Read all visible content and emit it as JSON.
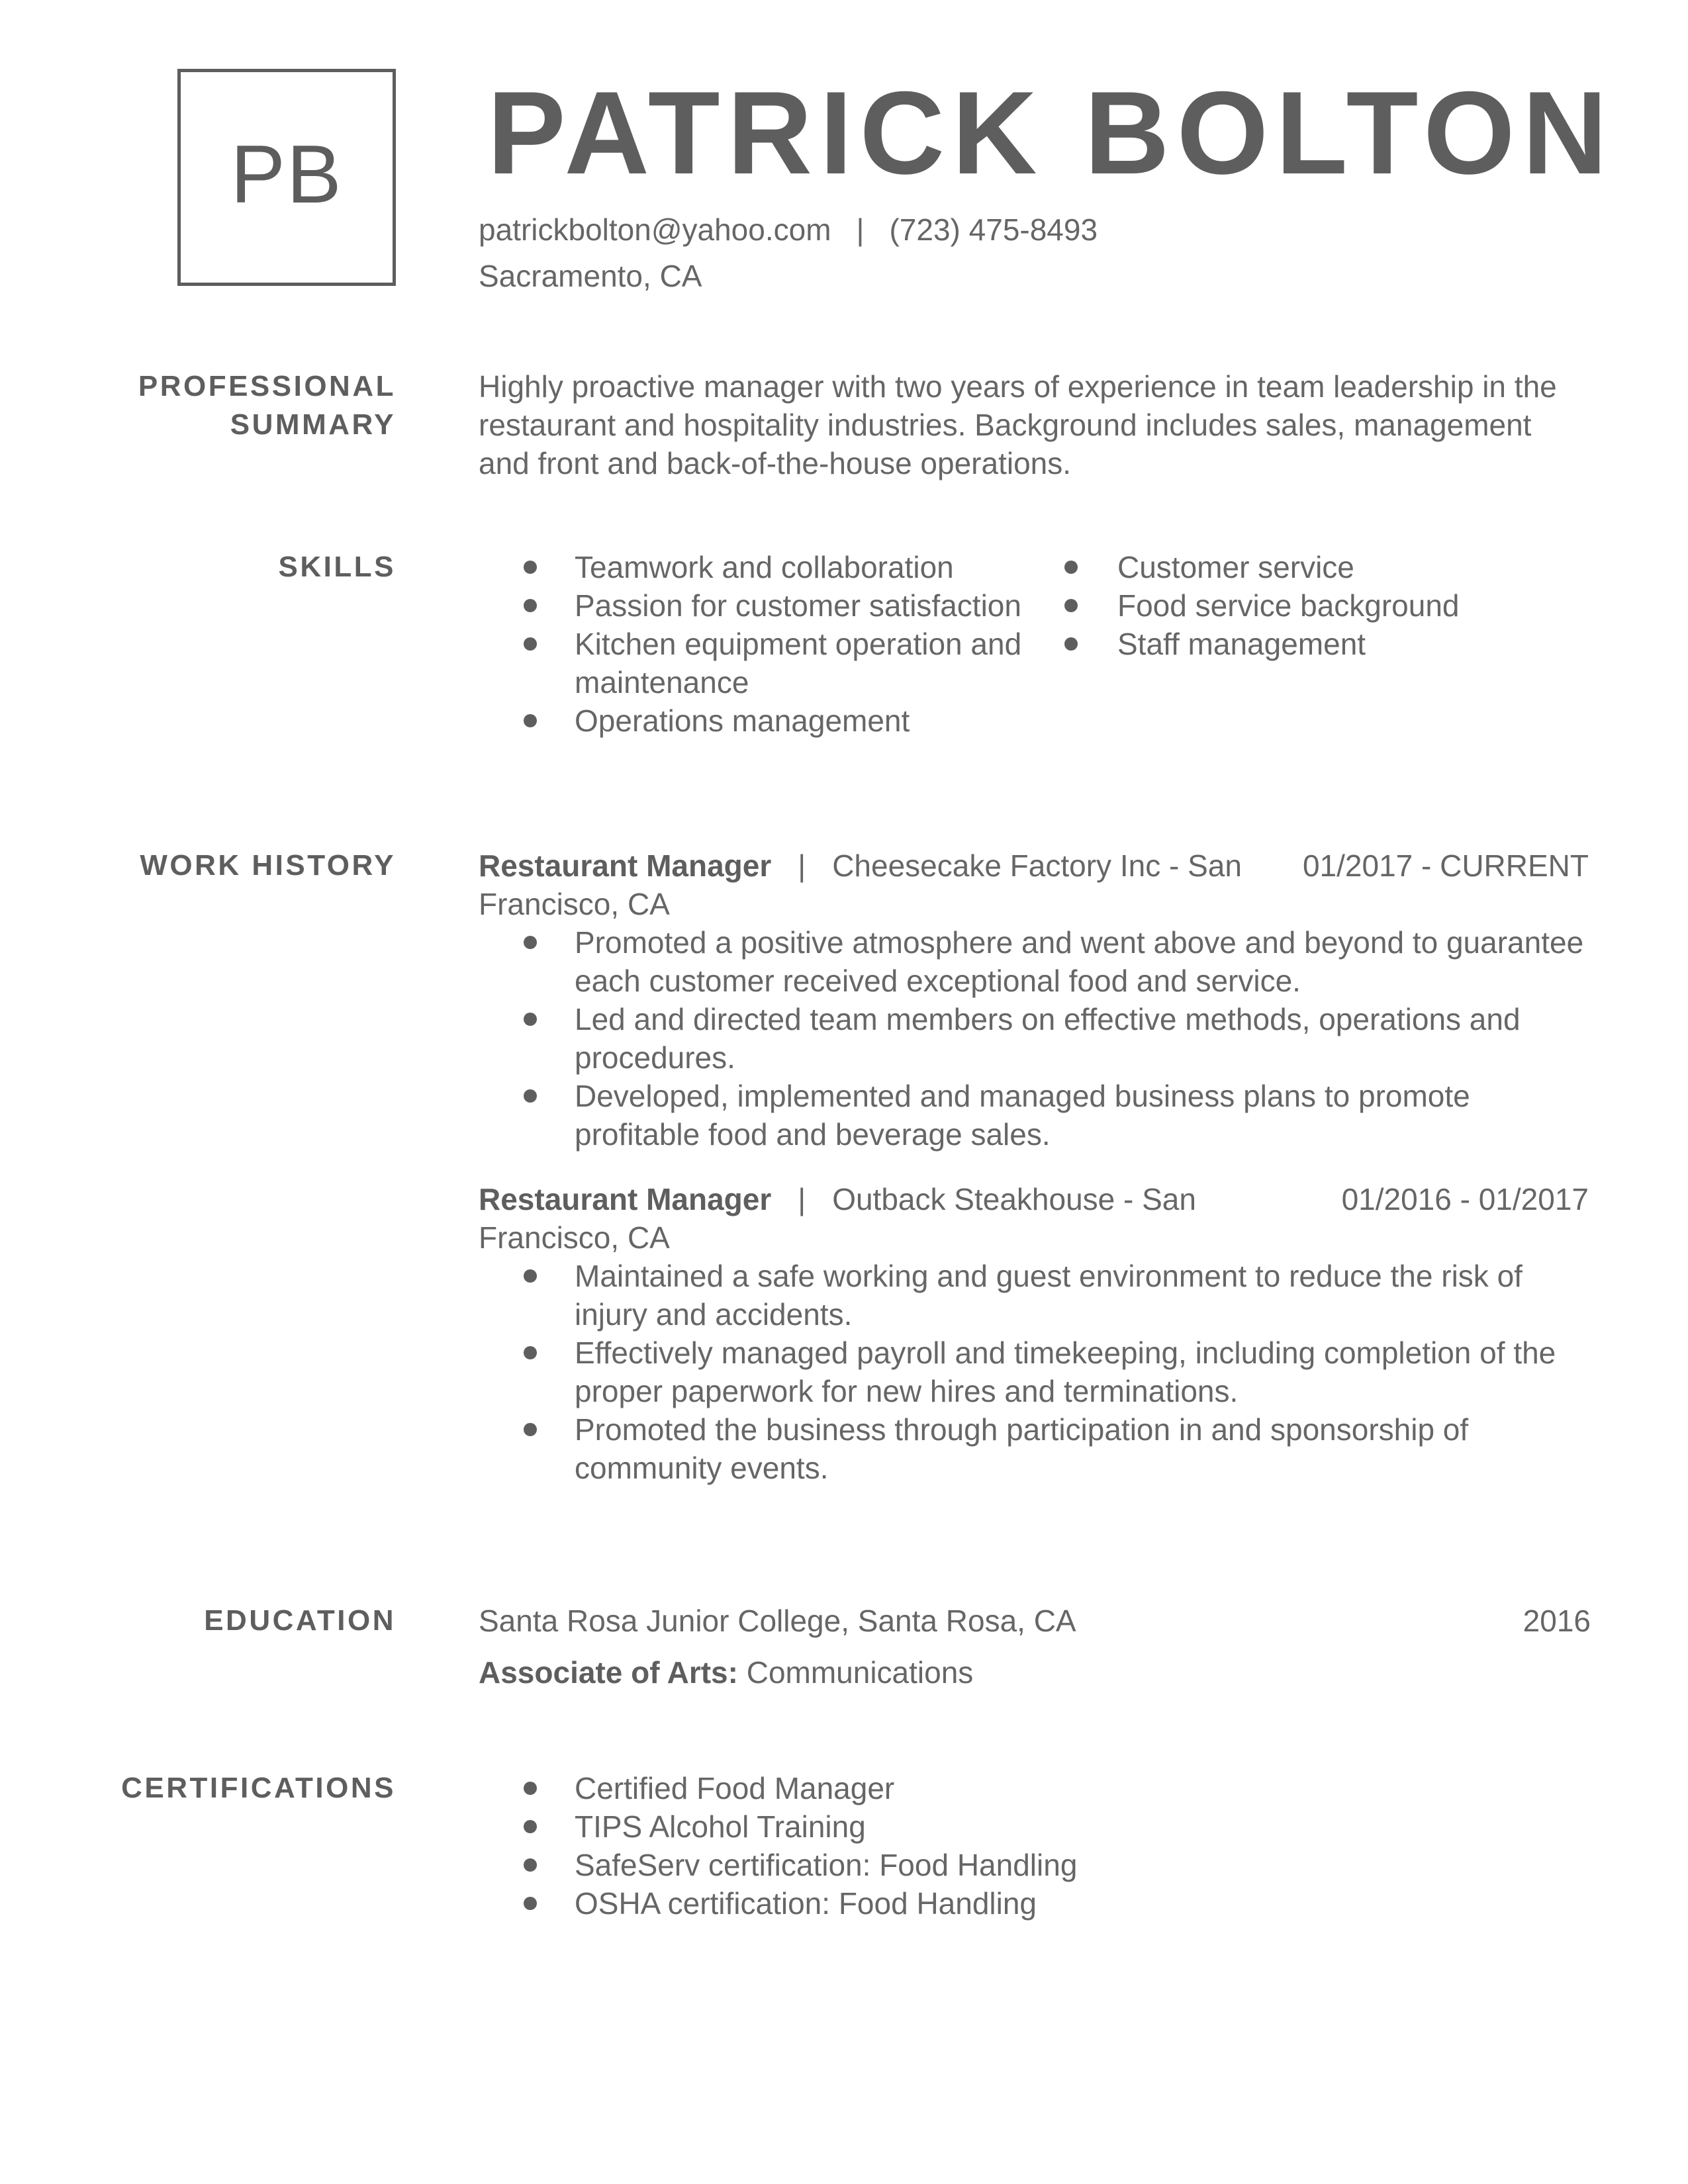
{
  "header": {
    "monogram": "PB",
    "name": "PATRICK BOLTON",
    "email": "patrickbolton@yahoo.com",
    "separator": "|",
    "phone": "(723) 475-8493",
    "location": "Sacramento, CA"
  },
  "summary": {
    "label_line1": "PROFESSIONAL",
    "label_line2": "SUMMARY",
    "text": "Highly proactive manager with two years of experience in team leadership in the restaurant and hospitality industries. Background includes sales, management and front and back-of-the-house operations."
  },
  "skills": {
    "label": "SKILLS",
    "column1": [
      "Teamwork and collaboration",
      "Passion for customer satisfaction",
      "Kitchen equipment operation and maintenance",
      "Operations management"
    ],
    "column2": [
      "Customer service",
      "Food service background",
      "Staff management"
    ]
  },
  "work_history": {
    "label": "WORK HISTORY",
    "jobs": [
      {
        "title": "Restaurant Manager",
        "separator": "|",
        "employer": "Cheesecake Factory Inc - San Francisco, CA",
        "dates": "01/2017 - CURRENT",
        "bullets": [
          "Promoted a positive atmosphere and went above and beyond to guarantee each customer received exceptional food and service.",
          "Led and directed team members on effective methods, operations and procedures.",
          "Developed, implemented and managed business plans to promote profitable food and beverage sales."
        ]
      },
      {
        "title": "Restaurant Manager",
        "separator": "|",
        "employer": "Outback Steakhouse - San Francisco, CA",
        "dates": "01/2016 - 01/2017",
        "bullets": [
          "Maintained a safe working and guest environment to reduce the risk of injury and accidents.",
          "Effectively managed payroll and timekeeping, including completion of the proper paperwork for new hires and terminations.",
          "Promoted the business through participation in and sponsorship of community events."
        ]
      }
    ]
  },
  "education": {
    "label": "EDUCATION",
    "school": "Santa Rosa Junior College, Santa Rosa, CA",
    "year": "2016",
    "degree": "Associate of Arts:",
    "field": "Communications"
  },
  "certifications": {
    "label": "CERTIFICATIONS",
    "items": [
      "Certified Food Manager",
      "TIPS Alcohol Training",
      "SafeServ certification: Food Handling",
      "OSHA certification: Food Handling"
    ]
  },
  "colors": {
    "text": "#5e5e5e",
    "body_text": "#666666",
    "background": "#ffffff"
  }
}
